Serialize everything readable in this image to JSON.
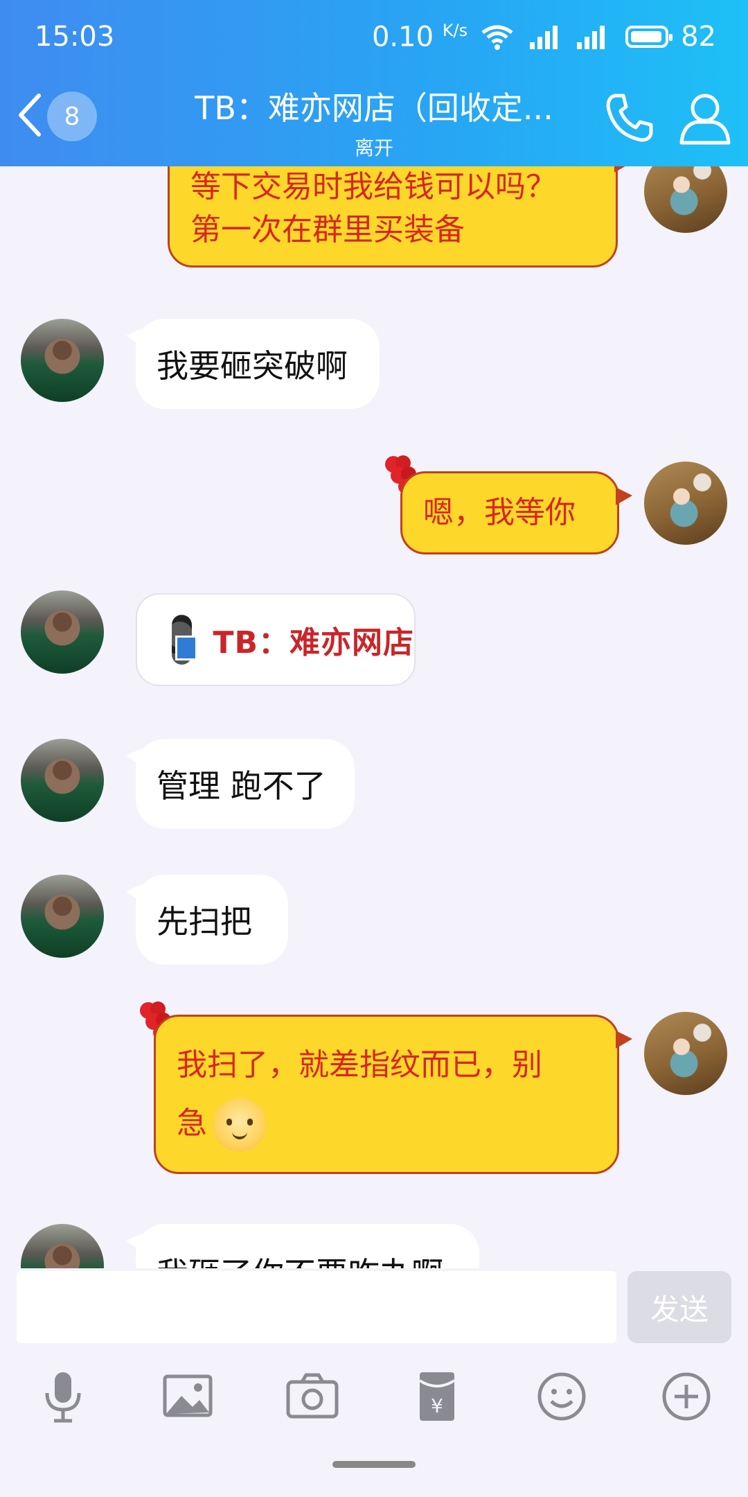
{
  "status_bar": {
    "time": "15:03",
    "net_speed": "0.10",
    "net_unit": "K/s",
    "battery": "82"
  },
  "header": {
    "unread_count": "8",
    "title": "TB：难亦网店（回收定...",
    "status": "离开"
  },
  "messages": [
    {
      "side": "out",
      "text": "等下交易时我给钱可以吗？\n第一次在群里买装备"
    },
    {
      "side": "in",
      "text": "我要砸突破啊"
    },
    {
      "side": "out",
      "text": "嗯，我等你"
    },
    {
      "side": "in",
      "type": "link-card",
      "text": "TB：难亦网店"
    },
    {
      "side": "in",
      "text": "管理 跑不了"
    },
    {
      "side": "in",
      "text": "先扫把"
    },
    {
      "side": "out",
      "text_line1": "我扫了，就差指纹而已，别",
      "text_line2": "急"
    },
    {
      "side": "in",
      "text": "我砸了你不要咋办啊"
    }
  ],
  "input": {
    "placeholder": "",
    "send_label": "发送"
  },
  "toolbar": [
    "microphone-icon",
    "image-icon",
    "camera-icon",
    "red-packet-icon",
    "emoji-icon",
    "plus-icon"
  ],
  "colors": {
    "header_start": "#3f8cf0",
    "header_end": "#1ec0f7",
    "out_bubble": "#fdd82a",
    "out_text": "#d8261c",
    "background": "#f4f2fa"
  }
}
